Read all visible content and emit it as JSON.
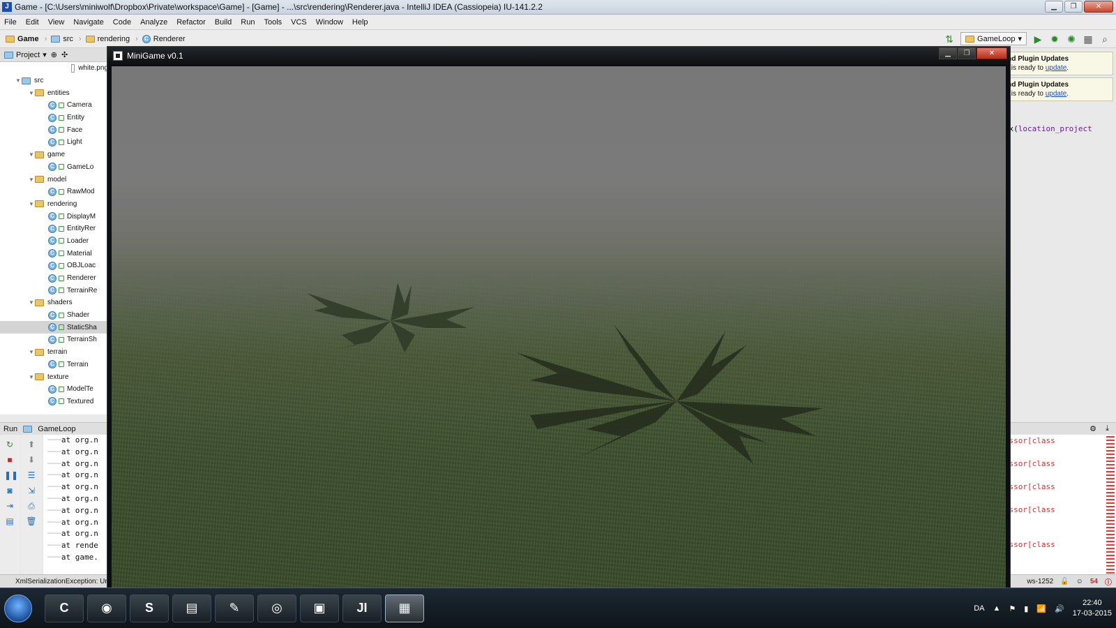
{
  "ide": {
    "window_title": "Game - [C:\\Users\\miniwolf\\Dropbox\\Private\\workspace\\Game] - [Game] - ...\\src\\rendering\\Renderer.java - IntelliJ IDEA (Cassiopeia) IU-141.2.2",
    "window_buttons": {
      "minimize": "▁",
      "maximize": "❐",
      "close": "✕"
    },
    "menu": [
      "File",
      "Edit",
      "View",
      "Navigate",
      "Code",
      "Analyze",
      "Refactor",
      "Build",
      "Run",
      "Tools",
      "VCS",
      "Window",
      "Help"
    ],
    "breadcrumbs": [
      "Game",
      "src",
      "rendering",
      "Renderer"
    ],
    "run_config": "GameLoop",
    "project_tab": "Project",
    "tree": [
      {
        "label": "white.png",
        "kind": "file",
        "indent": 5
      },
      {
        "label": "src",
        "kind": "folder-blue",
        "indent": 1,
        "open": true
      },
      {
        "label": "entities",
        "kind": "package",
        "indent": 2,
        "open": true
      },
      {
        "label": "Camera",
        "kind": "class",
        "indent": 3
      },
      {
        "label": "Entity",
        "kind": "class",
        "indent": 3
      },
      {
        "label": "Face",
        "kind": "class",
        "indent": 3
      },
      {
        "label": "Light",
        "kind": "class",
        "indent": 3
      },
      {
        "label": "game",
        "kind": "package",
        "indent": 2,
        "open": true
      },
      {
        "label": "GameLo",
        "kind": "class-run",
        "indent": 3
      },
      {
        "label": "model",
        "kind": "package",
        "indent": 2,
        "open": true
      },
      {
        "label": "RawMod",
        "kind": "class",
        "indent": 3
      },
      {
        "label": "rendering",
        "kind": "package",
        "indent": 2,
        "open": true
      },
      {
        "label": "DisplayM",
        "kind": "class",
        "indent": 3
      },
      {
        "label": "EntityRer",
        "kind": "class",
        "indent": 3
      },
      {
        "label": "Loader",
        "kind": "class",
        "indent": 3
      },
      {
        "label": "Material",
        "kind": "class",
        "indent": 3
      },
      {
        "label": "OBJLoac",
        "kind": "class",
        "indent": 3
      },
      {
        "label": "Renderer",
        "kind": "class",
        "indent": 3
      },
      {
        "label": "TerrainRe",
        "kind": "class",
        "indent": 3
      },
      {
        "label": "shaders",
        "kind": "package",
        "indent": 2,
        "open": true
      },
      {
        "label": "Shader",
        "kind": "class",
        "indent": 3
      },
      {
        "label": "StaticSha",
        "kind": "class",
        "indent": 3,
        "selected": true
      },
      {
        "label": "TerrainSh",
        "kind": "class",
        "indent": 3
      },
      {
        "label": "terrain",
        "kind": "package",
        "indent": 2,
        "open": true
      },
      {
        "label": "Terrain",
        "kind": "class",
        "indent": 3
      },
      {
        "label": "texture",
        "kind": "package",
        "indent": 2,
        "open": true
      },
      {
        "label": "ModelTe",
        "kind": "class",
        "indent": 3
      },
      {
        "label": "Textured",
        "kind": "class",
        "indent": 3
      }
    ],
    "notifications": [
      {
        "title": "m and Plugin Updates",
        "text": "DEA is ready to ",
        "link": "update",
        "tail": "."
      },
      {
        "title": "m and Plugin Updates",
        "text": "DEA is ready to ",
        "link": "update",
        "tail": "."
      }
    ],
    "editor_line": {
      "pre": "atrix(",
      "param": "location_project"
    },
    "run_panel": {
      "label": "Run",
      "config": "GameLoop",
      "console_lines": [
        "at org.n",
        "at org.n",
        "at org.n",
        "at org.n",
        "at org.n",
        "at org.n",
        "at org.n",
        "at org.n",
        "at org.n",
        "at rende",
        "at game."
      ],
      "error_lines": [
        "Accessor[class",
        "Accessor[class",
        "Accessor[class",
        "Accessor[class",
        "Accessor[class"
      ]
    },
    "status": {
      "message": "XmlSerializationException: Un",
      "encoding": "ws-1252",
      "error_count": "54"
    }
  },
  "game": {
    "window_title": "MiniGame v0.1",
    "window_buttons": {
      "minimize": "▁",
      "maximize": "❐",
      "close": "✕"
    },
    "colors": {
      "fog": "#787878",
      "grass": "#3a4b2b",
      "fern": "#2d3622"
    }
  },
  "taskbar": {
    "apps": [
      {
        "name": "ccleaner",
        "glyph": "C"
      },
      {
        "name": "chrome",
        "glyph": "◉"
      },
      {
        "name": "skype",
        "glyph": "S"
      },
      {
        "name": "explorer",
        "glyph": "▤"
      },
      {
        "name": "notepad",
        "glyph": "✎"
      },
      {
        "name": "speaker",
        "glyph": "◎"
      },
      {
        "name": "monitor",
        "glyph": "▣"
      },
      {
        "name": "intellij",
        "glyph": "JI"
      },
      {
        "name": "minigame",
        "glyph": "▦",
        "active": true
      }
    ],
    "language": "DA",
    "time": "22:40",
    "date": "17-03-2015"
  }
}
